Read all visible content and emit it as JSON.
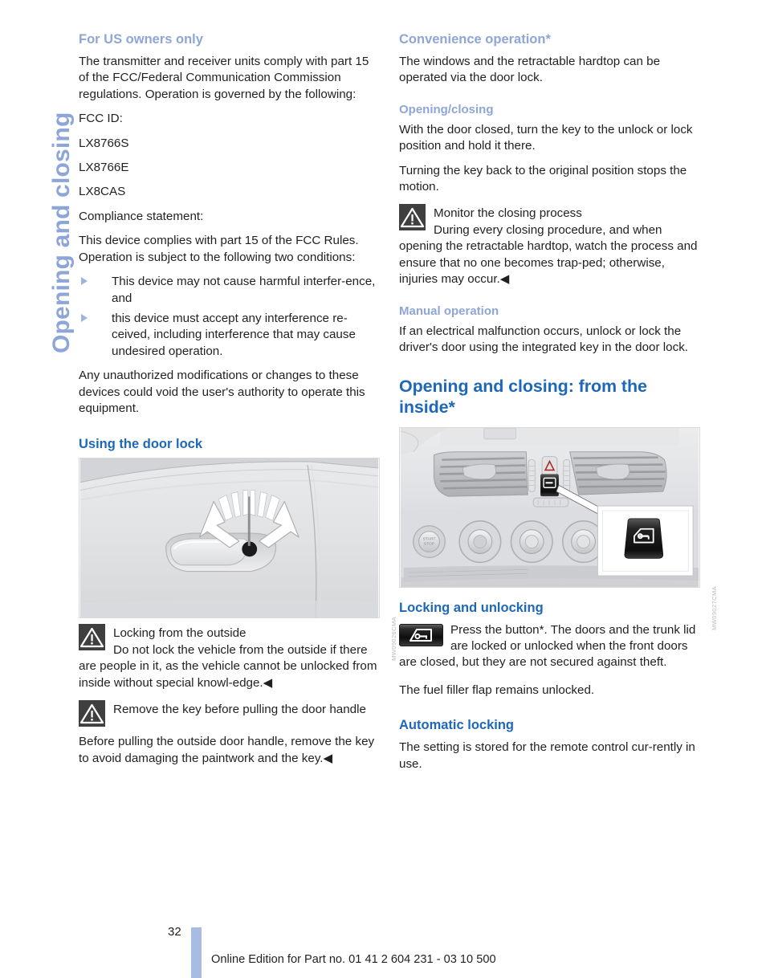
{
  "chapter": {
    "tab_label": "Opening and closing"
  },
  "left_column": {
    "heading_us": "For US owners only",
    "p_transmitter": "The transmitter and receiver units comply with part 15 of the FCC/Federal Communication Commission regulations. Operation is governed by the following:",
    "p_fcc_id_label": "FCC ID:",
    "fcc_ids": [
      "LX8766S",
      "LX8766E",
      "LX8CAS"
    ],
    "p_compliance_label": "Compliance statement:",
    "p_device_complies": "This device complies with part 15 of the FCC Rules. Operation is subject to the following two conditions:",
    "bullets": [
      "This device may not cause harmful interfer-ence, and",
      "this device must accept any interference re-ceived, including interference that may cause undesired operation."
    ],
    "p_unauthorized": "Any unauthorized modifications or changes to these devices could void the user's authority to operate this equipment.",
    "heading_door_lock": "Using the door lock",
    "figure_door_handle": {
      "code": "MW09026CMA",
      "alt": "Car door handle with key lock and arrows showing turning the key left or right"
    },
    "warning_locking_outside": {
      "icon": "warning-triangle-icon",
      "title": "Locking from the outside",
      "body": "Do not lock the vehicle from the outside if there are people in it, as the vehicle cannot be unlocked from inside without special knowl-edge.◀"
    },
    "warning_remove_key": {
      "icon": "warning-triangle-icon",
      "title": "Remove the key before pulling the door handle",
      "body": ""
    },
    "p_before_pulling": "Before pulling the outside door handle, remove the key to avoid damaging the paintwork and the key.◀"
  },
  "right_column": {
    "heading_convenience": "Convenience operation*",
    "p_windows": "The windows and the retractable hardtop can be operated via the door lock.",
    "subheading_opening_closing": "Opening/closing",
    "p_with_door_closed": "With the door closed, turn the key to the unlock or lock position and hold it there.",
    "p_turning_key_back": "Turning the key back to the original position stops the motion.",
    "warning_monitor": {
      "icon": "warning-triangle-icon",
      "title": "Monitor the closing process",
      "body": "During every closing procedure, and when opening the retractable hardtop, watch the process and ensure that no one becomes trap-ped; otherwise, injuries may occur.◀"
    },
    "subheading_manual_operation": "Manual operation",
    "p_manual": "If an electrical malfunction occurs, unlock or lock the driver's door using the integrated key in the door lock.",
    "heading_inside": "Opening and closing: from the inside*",
    "figure_console": {
      "code": "MW09027CMA",
      "alt": "Center console with air vents, hazard light button, central locking button and climate controls, with an inset callout of the door lock button"
    },
    "heading_locking_unlocking": "Locking and unlocking",
    "button_block": {
      "icon": "door-lock-button-icon",
      "title": "Press the button*.",
      "body": "The doors and the trunk lid are locked or unlocked when the front doors are closed, but they are not secured against theft."
    },
    "p_fuel_flap": "The fuel filler flap remains unlocked.",
    "heading_automatic_locking": "Automatic locking",
    "p_setting_stored": "The setting is stored for the remote control cur-rently in use."
  },
  "footer": {
    "page_number": "32",
    "edition_text": "Online Edition for Part no. 01 41 2 604 231 - 03 10 500"
  },
  "colors": {
    "heading_strong": "#1d68b8",
    "heading_soft": "#8ea6d7",
    "tab_blue": "#8ea6d7",
    "footer_bar": "#a8bbe2",
    "warn_icon_bg": "#3f3f3f",
    "body_text": "#231f20"
  }
}
